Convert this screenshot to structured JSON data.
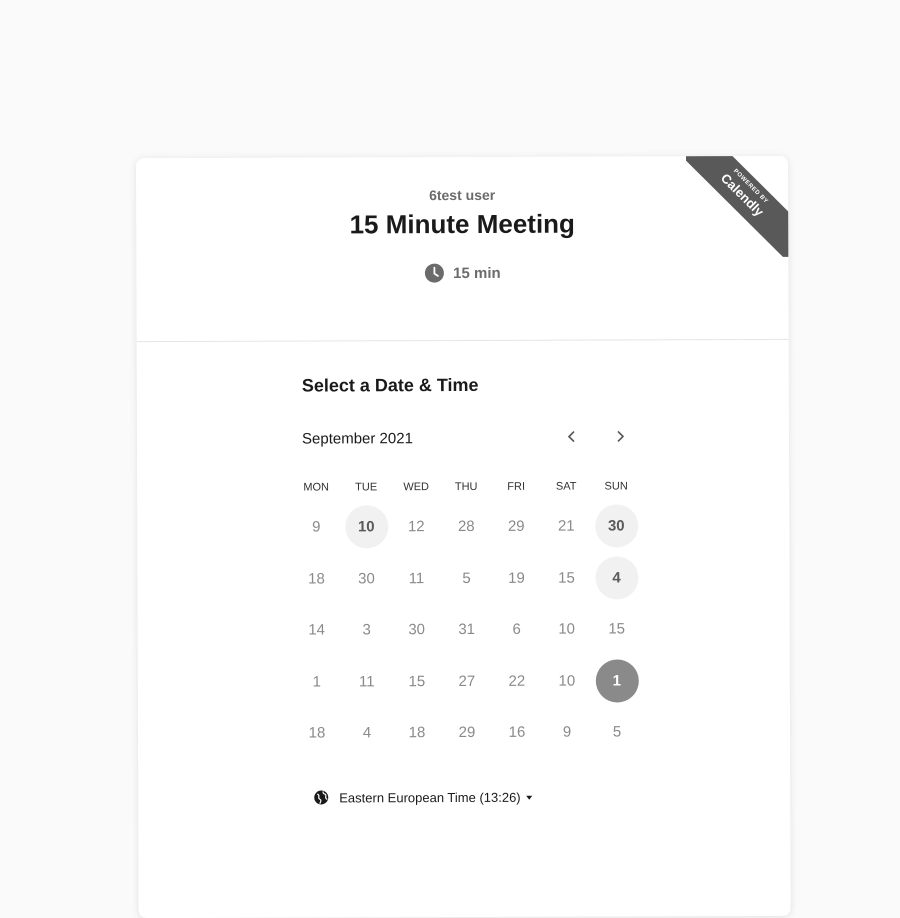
{
  "ribbon": {
    "small_text": "POWERED BY",
    "brand": "Calendly"
  },
  "header": {
    "host_name": "6test user",
    "event_title": "15 Minute Meeting",
    "duration": "15 min",
    "duration_icon": "clock-icon"
  },
  "picker": {
    "title": "Select a Date & Time",
    "month": "September 2021",
    "prev_icon": "chevron-left-icon",
    "next_icon": "chevron-right-icon",
    "weekdays": [
      "MON",
      "TUE",
      "WED",
      "THU",
      "FRI",
      "SAT",
      "SUN"
    ],
    "weeks": [
      [
        {
          "label": "9",
          "state": "disabled"
        },
        {
          "label": "10",
          "state": "available"
        },
        {
          "label": "12",
          "state": "disabled"
        },
        {
          "label": "28",
          "state": "disabled"
        },
        {
          "label": "29",
          "state": "disabled"
        },
        {
          "label": "21",
          "state": "disabled"
        },
        {
          "label": "30",
          "state": "available"
        }
      ],
      [
        {
          "label": "18",
          "state": "disabled"
        },
        {
          "label": "30",
          "state": "disabled"
        },
        {
          "label": "11",
          "state": "disabled"
        },
        {
          "label": "5",
          "state": "disabled"
        },
        {
          "label": "19",
          "state": "disabled"
        },
        {
          "label": "15",
          "state": "disabled"
        },
        {
          "label": "4",
          "state": "available"
        }
      ],
      [
        {
          "label": "14",
          "state": "disabled"
        },
        {
          "label": "3",
          "state": "disabled"
        },
        {
          "label": "30",
          "state": "disabled"
        },
        {
          "label": "31",
          "state": "disabled"
        },
        {
          "label": "6",
          "state": "disabled"
        },
        {
          "label": "10",
          "state": "disabled"
        },
        {
          "label": "15",
          "state": "disabled"
        }
      ],
      [
        {
          "label": "1",
          "state": "disabled"
        },
        {
          "label": "11",
          "state": "disabled"
        },
        {
          "label": "15",
          "state": "disabled"
        },
        {
          "label": "27",
          "state": "disabled"
        },
        {
          "label": "22",
          "state": "disabled"
        },
        {
          "label": "10",
          "state": "disabled"
        },
        {
          "label": "1",
          "state": "selected"
        }
      ],
      [
        {
          "label": "18",
          "state": "disabled"
        },
        {
          "label": "4",
          "state": "disabled"
        },
        {
          "label": "18",
          "state": "disabled"
        },
        {
          "label": "29",
          "state": "disabled"
        },
        {
          "label": "16",
          "state": "disabled"
        },
        {
          "label": "9",
          "state": "disabled"
        },
        {
          "label": "5",
          "state": "disabled"
        }
      ]
    ],
    "timezone": "Eastern European Time (13:26)",
    "timezone_icon": "globe-icon"
  },
  "colors": {
    "page_bg": "#fafafa",
    "selected_day": "#8a8a8a",
    "available_day_bg": "#f1f1f1",
    "ribbon": "#595959"
  }
}
